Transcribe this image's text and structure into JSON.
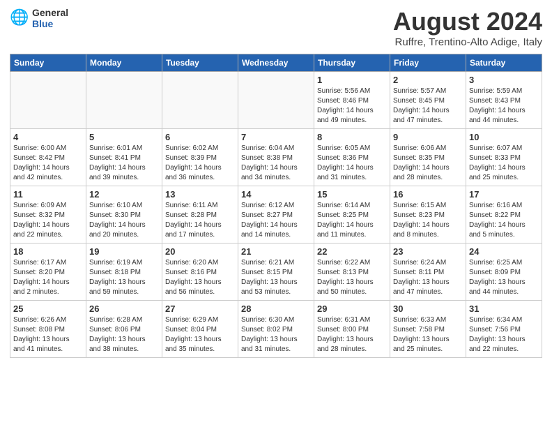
{
  "header": {
    "logo_general": "General",
    "logo_blue": "Blue",
    "month_title": "August 2024",
    "location": "Ruffre, Trentino-Alto Adige, Italy"
  },
  "days_of_week": [
    "Sunday",
    "Monday",
    "Tuesday",
    "Wednesday",
    "Thursday",
    "Friday",
    "Saturday"
  ],
  "weeks": [
    [
      {
        "num": "",
        "info": "",
        "empty": true
      },
      {
        "num": "",
        "info": "",
        "empty": true
      },
      {
        "num": "",
        "info": "",
        "empty": true
      },
      {
        "num": "",
        "info": "",
        "empty": true
      },
      {
        "num": "1",
        "info": "Sunrise: 5:56 AM\nSunset: 8:46 PM\nDaylight: 14 hours\nand 49 minutes."
      },
      {
        "num": "2",
        "info": "Sunrise: 5:57 AM\nSunset: 8:45 PM\nDaylight: 14 hours\nand 47 minutes."
      },
      {
        "num": "3",
        "info": "Sunrise: 5:59 AM\nSunset: 8:43 PM\nDaylight: 14 hours\nand 44 minutes."
      }
    ],
    [
      {
        "num": "4",
        "info": "Sunrise: 6:00 AM\nSunset: 8:42 PM\nDaylight: 14 hours\nand 42 minutes."
      },
      {
        "num": "5",
        "info": "Sunrise: 6:01 AM\nSunset: 8:41 PM\nDaylight: 14 hours\nand 39 minutes."
      },
      {
        "num": "6",
        "info": "Sunrise: 6:02 AM\nSunset: 8:39 PM\nDaylight: 14 hours\nand 36 minutes."
      },
      {
        "num": "7",
        "info": "Sunrise: 6:04 AM\nSunset: 8:38 PM\nDaylight: 14 hours\nand 34 minutes."
      },
      {
        "num": "8",
        "info": "Sunrise: 6:05 AM\nSunset: 8:36 PM\nDaylight: 14 hours\nand 31 minutes."
      },
      {
        "num": "9",
        "info": "Sunrise: 6:06 AM\nSunset: 8:35 PM\nDaylight: 14 hours\nand 28 minutes."
      },
      {
        "num": "10",
        "info": "Sunrise: 6:07 AM\nSunset: 8:33 PM\nDaylight: 14 hours\nand 25 minutes."
      }
    ],
    [
      {
        "num": "11",
        "info": "Sunrise: 6:09 AM\nSunset: 8:32 PM\nDaylight: 14 hours\nand 22 minutes."
      },
      {
        "num": "12",
        "info": "Sunrise: 6:10 AM\nSunset: 8:30 PM\nDaylight: 14 hours\nand 20 minutes."
      },
      {
        "num": "13",
        "info": "Sunrise: 6:11 AM\nSunset: 8:28 PM\nDaylight: 14 hours\nand 17 minutes."
      },
      {
        "num": "14",
        "info": "Sunrise: 6:12 AM\nSunset: 8:27 PM\nDaylight: 14 hours\nand 14 minutes."
      },
      {
        "num": "15",
        "info": "Sunrise: 6:14 AM\nSunset: 8:25 PM\nDaylight: 14 hours\nand 11 minutes."
      },
      {
        "num": "16",
        "info": "Sunrise: 6:15 AM\nSunset: 8:23 PM\nDaylight: 14 hours\nand 8 minutes."
      },
      {
        "num": "17",
        "info": "Sunrise: 6:16 AM\nSunset: 8:22 PM\nDaylight: 14 hours\nand 5 minutes."
      }
    ],
    [
      {
        "num": "18",
        "info": "Sunrise: 6:17 AM\nSunset: 8:20 PM\nDaylight: 14 hours\nand 2 minutes."
      },
      {
        "num": "19",
        "info": "Sunrise: 6:19 AM\nSunset: 8:18 PM\nDaylight: 13 hours\nand 59 minutes."
      },
      {
        "num": "20",
        "info": "Sunrise: 6:20 AM\nSunset: 8:16 PM\nDaylight: 13 hours\nand 56 minutes."
      },
      {
        "num": "21",
        "info": "Sunrise: 6:21 AM\nSunset: 8:15 PM\nDaylight: 13 hours\nand 53 minutes."
      },
      {
        "num": "22",
        "info": "Sunrise: 6:22 AM\nSunset: 8:13 PM\nDaylight: 13 hours\nand 50 minutes."
      },
      {
        "num": "23",
        "info": "Sunrise: 6:24 AM\nSunset: 8:11 PM\nDaylight: 13 hours\nand 47 minutes."
      },
      {
        "num": "24",
        "info": "Sunrise: 6:25 AM\nSunset: 8:09 PM\nDaylight: 13 hours\nand 44 minutes."
      }
    ],
    [
      {
        "num": "25",
        "info": "Sunrise: 6:26 AM\nSunset: 8:08 PM\nDaylight: 13 hours\nand 41 minutes."
      },
      {
        "num": "26",
        "info": "Sunrise: 6:28 AM\nSunset: 8:06 PM\nDaylight: 13 hours\nand 38 minutes."
      },
      {
        "num": "27",
        "info": "Sunrise: 6:29 AM\nSunset: 8:04 PM\nDaylight: 13 hours\nand 35 minutes."
      },
      {
        "num": "28",
        "info": "Sunrise: 6:30 AM\nSunset: 8:02 PM\nDaylight: 13 hours\nand 31 minutes."
      },
      {
        "num": "29",
        "info": "Sunrise: 6:31 AM\nSunset: 8:00 PM\nDaylight: 13 hours\nand 28 minutes."
      },
      {
        "num": "30",
        "info": "Sunrise: 6:33 AM\nSunset: 7:58 PM\nDaylight: 13 hours\nand 25 minutes."
      },
      {
        "num": "31",
        "info": "Sunrise: 6:34 AM\nSunset: 7:56 PM\nDaylight: 13 hours\nand 22 minutes."
      }
    ]
  ]
}
